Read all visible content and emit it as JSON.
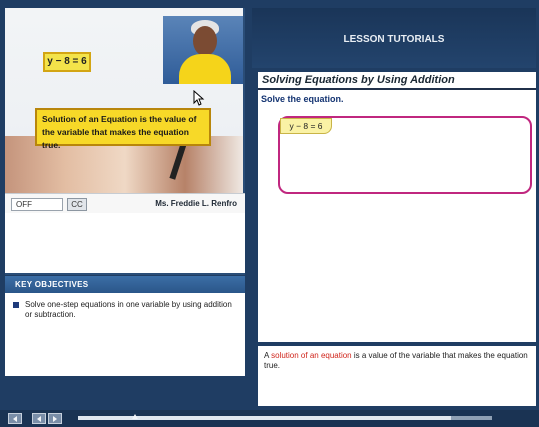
{
  "video": {
    "equation_card": "y − 8 = 6",
    "definition_card": "Solution of an Equation is the value of the variable that makes the equation true.",
    "caption_field_value": "OFF",
    "cc_label": "CC",
    "presenter_name": "Ms. Freddie L. Renfro"
  },
  "objectives": {
    "header": "KEY OBJECTIVES",
    "items": [
      "Solve one-step equations in one variable by using addition or subtraction."
    ]
  },
  "lesson": {
    "header": "LESSON TUTORIALS",
    "title": "Solving Equations by Using Addition",
    "prompt": "Solve the equation.",
    "equation_tag": "y − 8 = 6",
    "footer_prefix": "A ",
    "footer_highlight": "solution of an equation",
    "footer_suffix": " is a value of the variable that makes the equation true."
  },
  "controls": {
    "progress_percent": 90
  },
  "colors": {
    "accent_navy": "#1f3d63",
    "card_yellow": "#f7d928",
    "answer_border": "#c0277f",
    "highlight_red": "#d0261c"
  }
}
